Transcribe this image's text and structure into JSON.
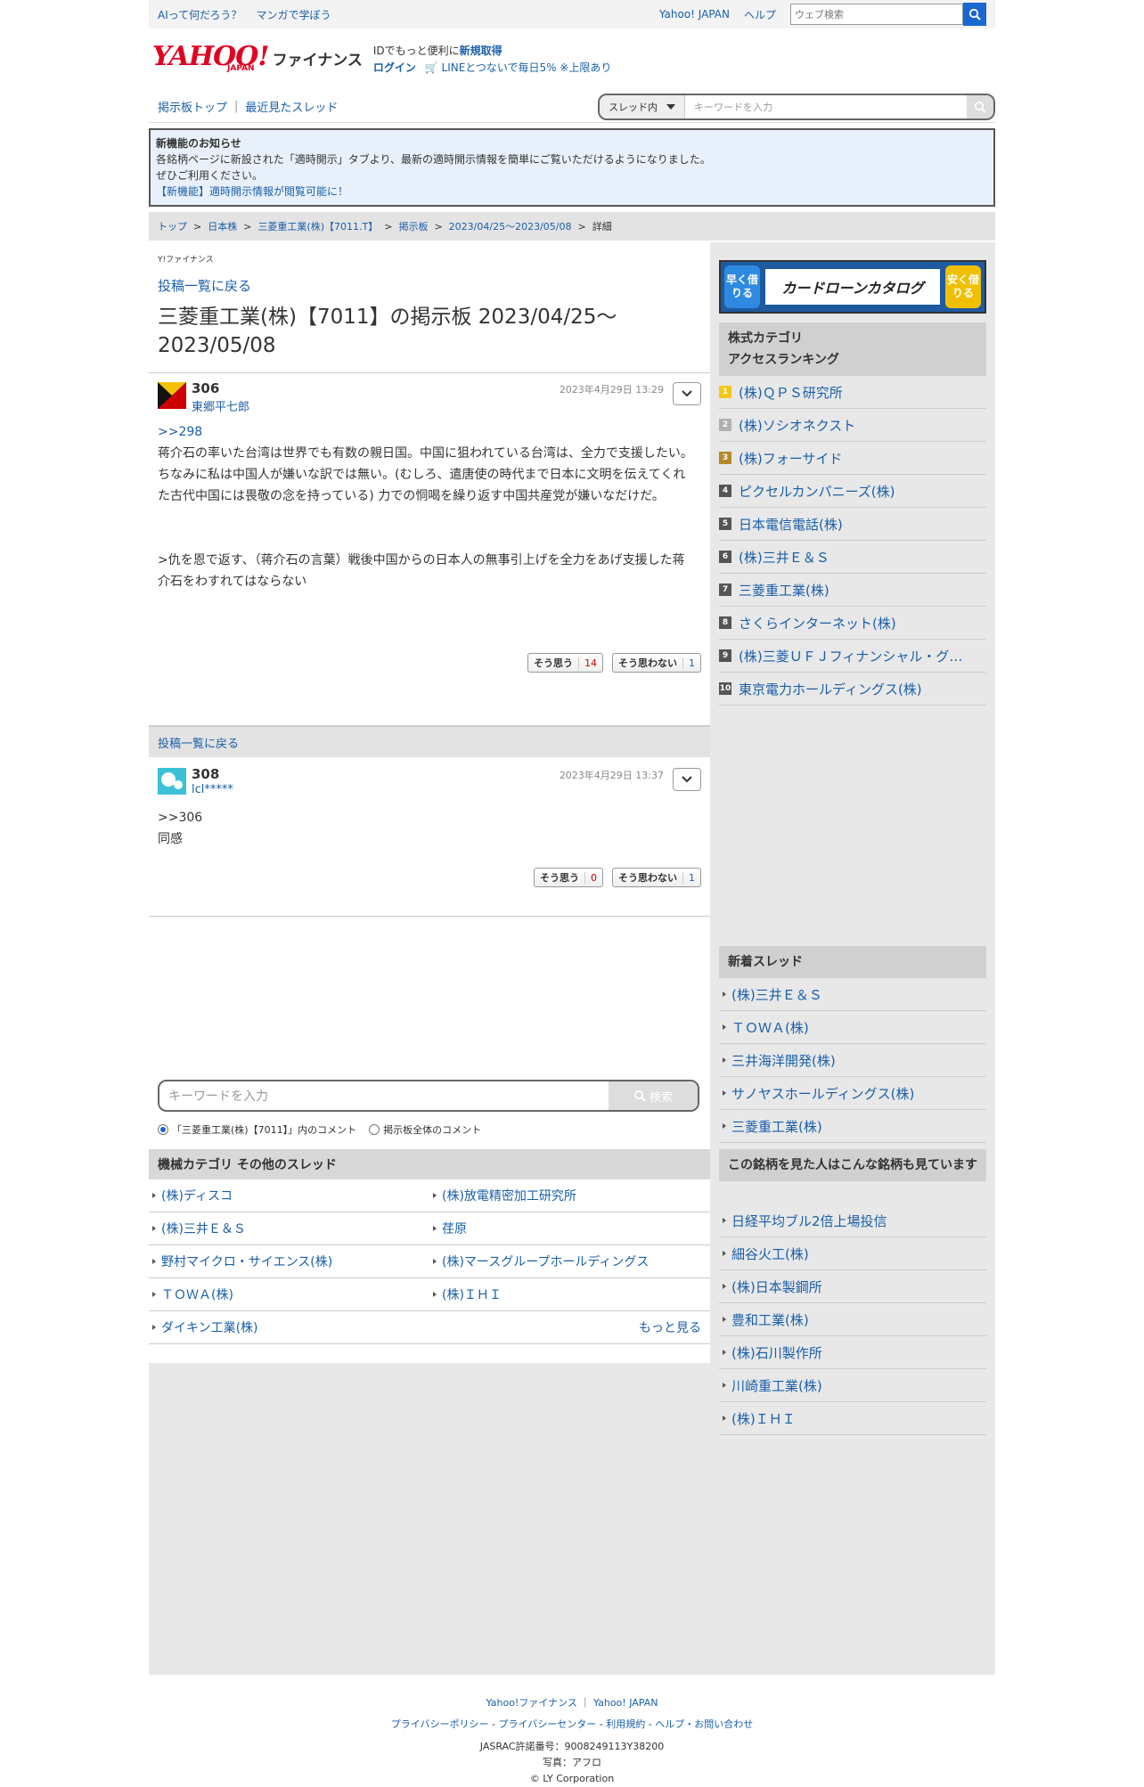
{
  "topbar": {
    "link1": "AIって何だろう？",
    "link2": "マンガで学ぼう",
    "yahoo_japan": "Yahoo! JAPAN",
    "help": "ヘルプ",
    "web_search_placeholder": "ウェブ検索"
  },
  "header": {
    "logo_text": "YAHOO!",
    "logo_sub": "JAPAN",
    "finance": "ファイナンス",
    "promo_prefix": "IDでもっと便利に",
    "promo_link": "新規取得",
    "login": "ログイン",
    "line_promo": "LINEとつないで毎日5% ※上限あり"
  },
  "boardnav": {
    "top": "掲示板トップ",
    "sep": "|",
    "recent": "最近見たスレッド",
    "scope": "スレッド内",
    "keyword_placeholder": "キーワードを入力"
  },
  "notice": {
    "title": "新機能のお知らせ",
    "line1": "各銘柄ページに新設された「適時開示」タブより、最新の適時開示情報を簡単にご覧いただけるようになりました。",
    "line2": "ぜひご利用ください。",
    "link": "【新機能】適時開示情報が閲覧可能に！"
  },
  "breadcrumb": {
    "items": [
      "トップ",
      "日本株",
      "三菱重工業(株)【7011.T】",
      "掲示板",
      "2023/04/25〜2023/05/08"
    ],
    "current": "詳細",
    "sep": ">"
  },
  "main": {
    "yf_small": "Y!ファイナンス",
    "back": "投稿一覧に戻る",
    "title": "三菱重工業(株)【7011】の掲示板 2023/04/25〜2023/05/08"
  },
  "posts": [
    {
      "number": "306",
      "user": "東郷平七郎",
      "date": "2023年4月29日 13:29",
      "reply": ">>298",
      "body1": "蒋介石の率いた台湾は世界でも有数の親日国。中国に狙われている台湾は、全力で支援したい。",
      "body2": "ちなみに私は中国人が嫌いな訳では無い。(むしろ、遣唐使の時代まで日本に文明を伝えてくれた古代中国には畏敬の念を持っている) 力での恫喝を繰り返す中国共産党が嫌いなだけだ。",
      "body3": ">仇を恩で返す、（蒋介石の言葉）戦後中国からの日本人の無事引上げを全力をあげ支援した蒋介石をわすれてはならない",
      "agree_label": "そう思う",
      "agree": "14",
      "disagree_label": "そう思わない",
      "disagree": "1"
    },
    {
      "number": "308",
      "user": "lcl*****",
      "date": "2023年4月29日 13:37",
      "reply": ">>306",
      "body1": "同感",
      "agree_label": "そう思う",
      "agree": "0",
      "disagree_label": "そう思わない",
      "disagree": "1"
    }
  ],
  "back2": "投稿一覧に戻る",
  "search": {
    "placeholder": "キーワードを入力",
    "button": "検索",
    "radio1": "「三菱重工業(株)【7011】」内のコメント",
    "radio2": "掲示板全体のコメント"
  },
  "category": {
    "title": "機械カテゴリ その他のスレッド",
    "items": [
      "(株)ディスコ",
      "(株)放電精密加工研究所",
      "(株)三井Ｅ＆Ｓ",
      "荏原",
      "野村マイクロ・サイエンス(株)",
      "(株)マースグループホールディングス",
      "ＴＯＷＡ(株)",
      "(株)ＩＨＩ",
      "ダイキン工業(株)"
    ],
    "more": "もっと見る"
  },
  "sidebar": {
    "ad": {
      "left": "早く借りる",
      "center": "カードローンカタログ",
      "right": "安く借りる"
    },
    "ranking_title1": "株式カテゴリ",
    "ranking_title2": "アクセスランキング",
    "ranking": [
      "(株)ＱＰＳ研究所",
      "(株)ソシオネクスト",
      "(株)フォーサイド",
      "ピクセルカンパニーズ(株)",
      "日本電信電話(株)",
      "(株)三井Ｅ＆Ｓ",
      "三菱重工業(株)",
      "さくらインターネット(株)",
      "(株)三菱ＵＦＪフィナンシャル・グ…",
      "東京電力ホールディングス(株)"
    ],
    "new_title": "新着スレッド",
    "new_threads": [
      "(株)三井Ｅ＆Ｓ",
      "ＴＯＷＡ(株)",
      "三井海洋開発(株)",
      "サノヤスホールディングス(株)",
      "三菱重工業(株)"
    ],
    "also_title": "この銘柄を見た人はこんな銘柄も見ています",
    "also": [
      "日経平均ブル2倍上場投信",
      "細谷火工(株)",
      "(株)日本製鋼所",
      "豊和工業(株)",
      "(株)石川製作所",
      "川崎重工業(株)",
      "(株)ＩＨＩ"
    ],
    "rank_colors": [
      "#f5c518",
      "#b0b0b0",
      "#b58a2a"
    ]
  },
  "footer": {
    "link1": "Yahoo!ファイナンス",
    "link2": "Yahoo! JAPAN",
    "privacy": "プライバシーポリシー",
    "privacy_center": "プライバシーセンター",
    "terms": "利用規約",
    "help": "ヘルプ・お問い合わせ",
    "jasrac": "JASRAC許諾番号：9008249113Y38200",
    "photo": "写真：アフロ",
    "copyright": "© LY Corporation"
  }
}
